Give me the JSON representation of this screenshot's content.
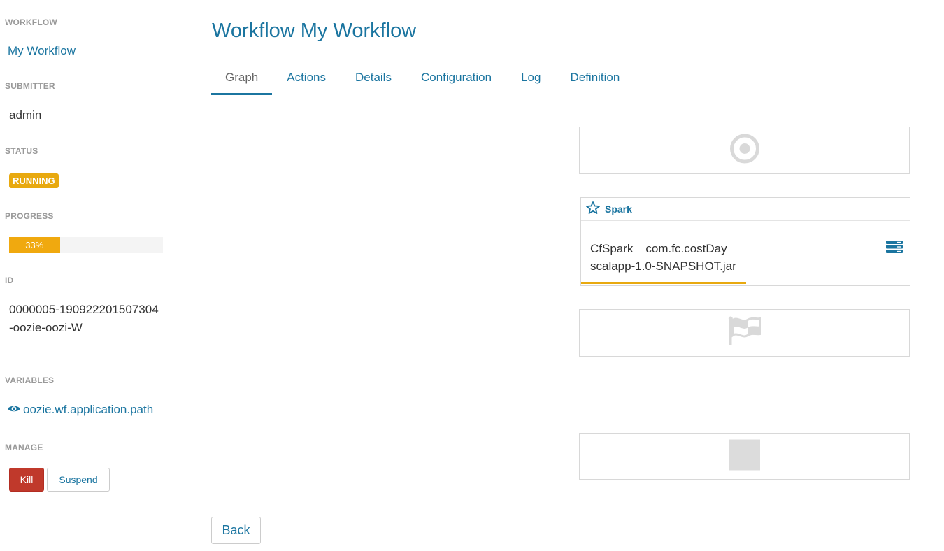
{
  "sidebar": {
    "workflow_label": "WORKFLOW",
    "workflow_name": "My Workflow",
    "submitter_label": "SUBMITTER",
    "submitter": "admin",
    "status_label": "STATUS",
    "status": "RUNNING",
    "progress_label": "PROGRESS",
    "progress_text": "33%",
    "progress_value": 33,
    "id_label": "ID",
    "id": "0000005-190922201507304-oozie-oozi-W",
    "variables_label": "VARIABLES",
    "variable": "oozie.wf.application.path",
    "manage_label": "MANAGE",
    "kill_label": "Kill",
    "suspend_label": "Suspend"
  },
  "main": {
    "title": "Workflow My Workflow",
    "tabs": [
      {
        "label": "Graph",
        "active": true
      },
      {
        "label": "Actions"
      },
      {
        "label": "Details"
      },
      {
        "label": "Configuration"
      },
      {
        "label": "Log"
      },
      {
        "label": "Definition"
      }
    ],
    "graph": {
      "start_icon": "start-target-icon",
      "action": {
        "type_icon": "spark-icon",
        "type": "Spark",
        "name": "CfSpark",
        "class": "com.fc.costDay",
        "jar": "scalapp-1.0-SNAPSHOT.jar",
        "menu_icon": "server-menu-icon"
      },
      "end_icon": "end-flag-icon",
      "kill_icon": "kill-stop-icon"
    },
    "back_label": "Back"
  },
  "colors": {
    "link": "#1b75a0",
    "status_running": "#e8a90f",
    "kill_button": "#c0392b",
    "label_gray": "#999999"
  }
}
